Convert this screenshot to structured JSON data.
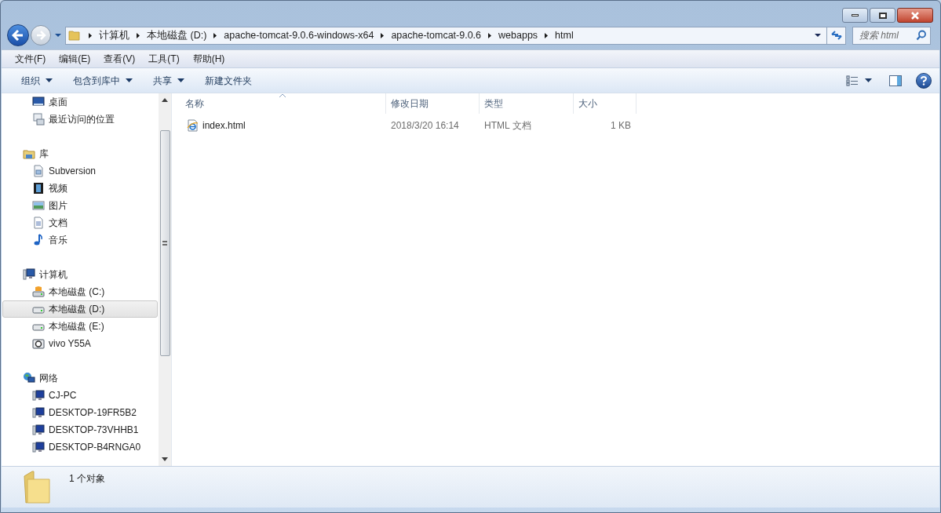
{
  "address_bar": {
    "breadcrumb": [
      "计算机",
      "本地磁盘 (D:)",
      "apache-tomcat-9.0.6-windows-x64",
      "apache-tomcat-9.0.6",
      "webapps",
      "html"
    ]
  },
  "search": {
    "placeholder": "搜索 html"
  },
  "menu": [
    "文件(F)",
    "编辑(E)",
    "查看(V)",
    "工具(T)",
    "帮助(H)"
  ],
  "toolbar": [
    {
      "label": "组织",
      "dropdown": true
    },
    {
      "label": "包含到库中",
      "dropdown": true
    },
    {
      "label": "共享",
      "dropdown": true
    },
    {
      "label": "新建文件夹",
      "dropdown": false
    }
  ],
  "sidebar": {
    "groups": [
      {
        "children": [
          {
            "label": "桌面",
            "selected": false
          },
          {
            "label": "最近访问的位置",
            "selected": false
          }
        ]
      },
      {
        "label": "库",
        "children": [
          {
            "label": "Subversion",
            "selected": false
          },
          {
            "label": "视频",
            "selected": false
          },
          {
            "label": "图片",
            "selected": false
          },
          {
            "label": "文档",
            "selected": false
          },
          {
            "label": "音乐",
            "selected": false
          }
        ]
      },
      {
        "label": "计算机",
        "children": [
          {
            "label": "本地磁盘 (C:)",
            "selected": false
          },
          {
            "label": "本地磁盘 (D:)",
            "selected": true
          },
          {
            "label": "本地磁盘 (E:)",
            "selected": false
          },
          {
            "label": "vivo Y55A",
            "selected": false
          }
        ]
      },
      {
        "label": "网络",
        "children": [
          {
            "label": "CJ-PC",
            "selected": false
          },
          {
            "label": "DESKTOP-19FR5B2",
            "selected": false
          },
          {
            "label": "DESKTOP-73VHHB1",
            "selected": false
          },
          {
            "label": "DESKTOP-B4RNGA0",
            "selected": false
          }
        ]
      }
    ]
  },
  "table": {
    "columns": [
      {
        "label": "名称",
        "sorted": true
      },
      {
        "label": "修改日期",
        "sorted": false
      },
      {
        "label": "类型",
        "sorted": false
      },
      {
        "label": "大小",
        "sorted": false
      }
    ],
    "rows": [
      {
        "name": "index.html",
        "date": "2018/3/20 16:14",
        "type": "HTML 文档",
        "size": "1 KB",
        "selected": false
      }
    ]
  },
  "status_bar": {
    "text": "1 个对象"
  }
}
